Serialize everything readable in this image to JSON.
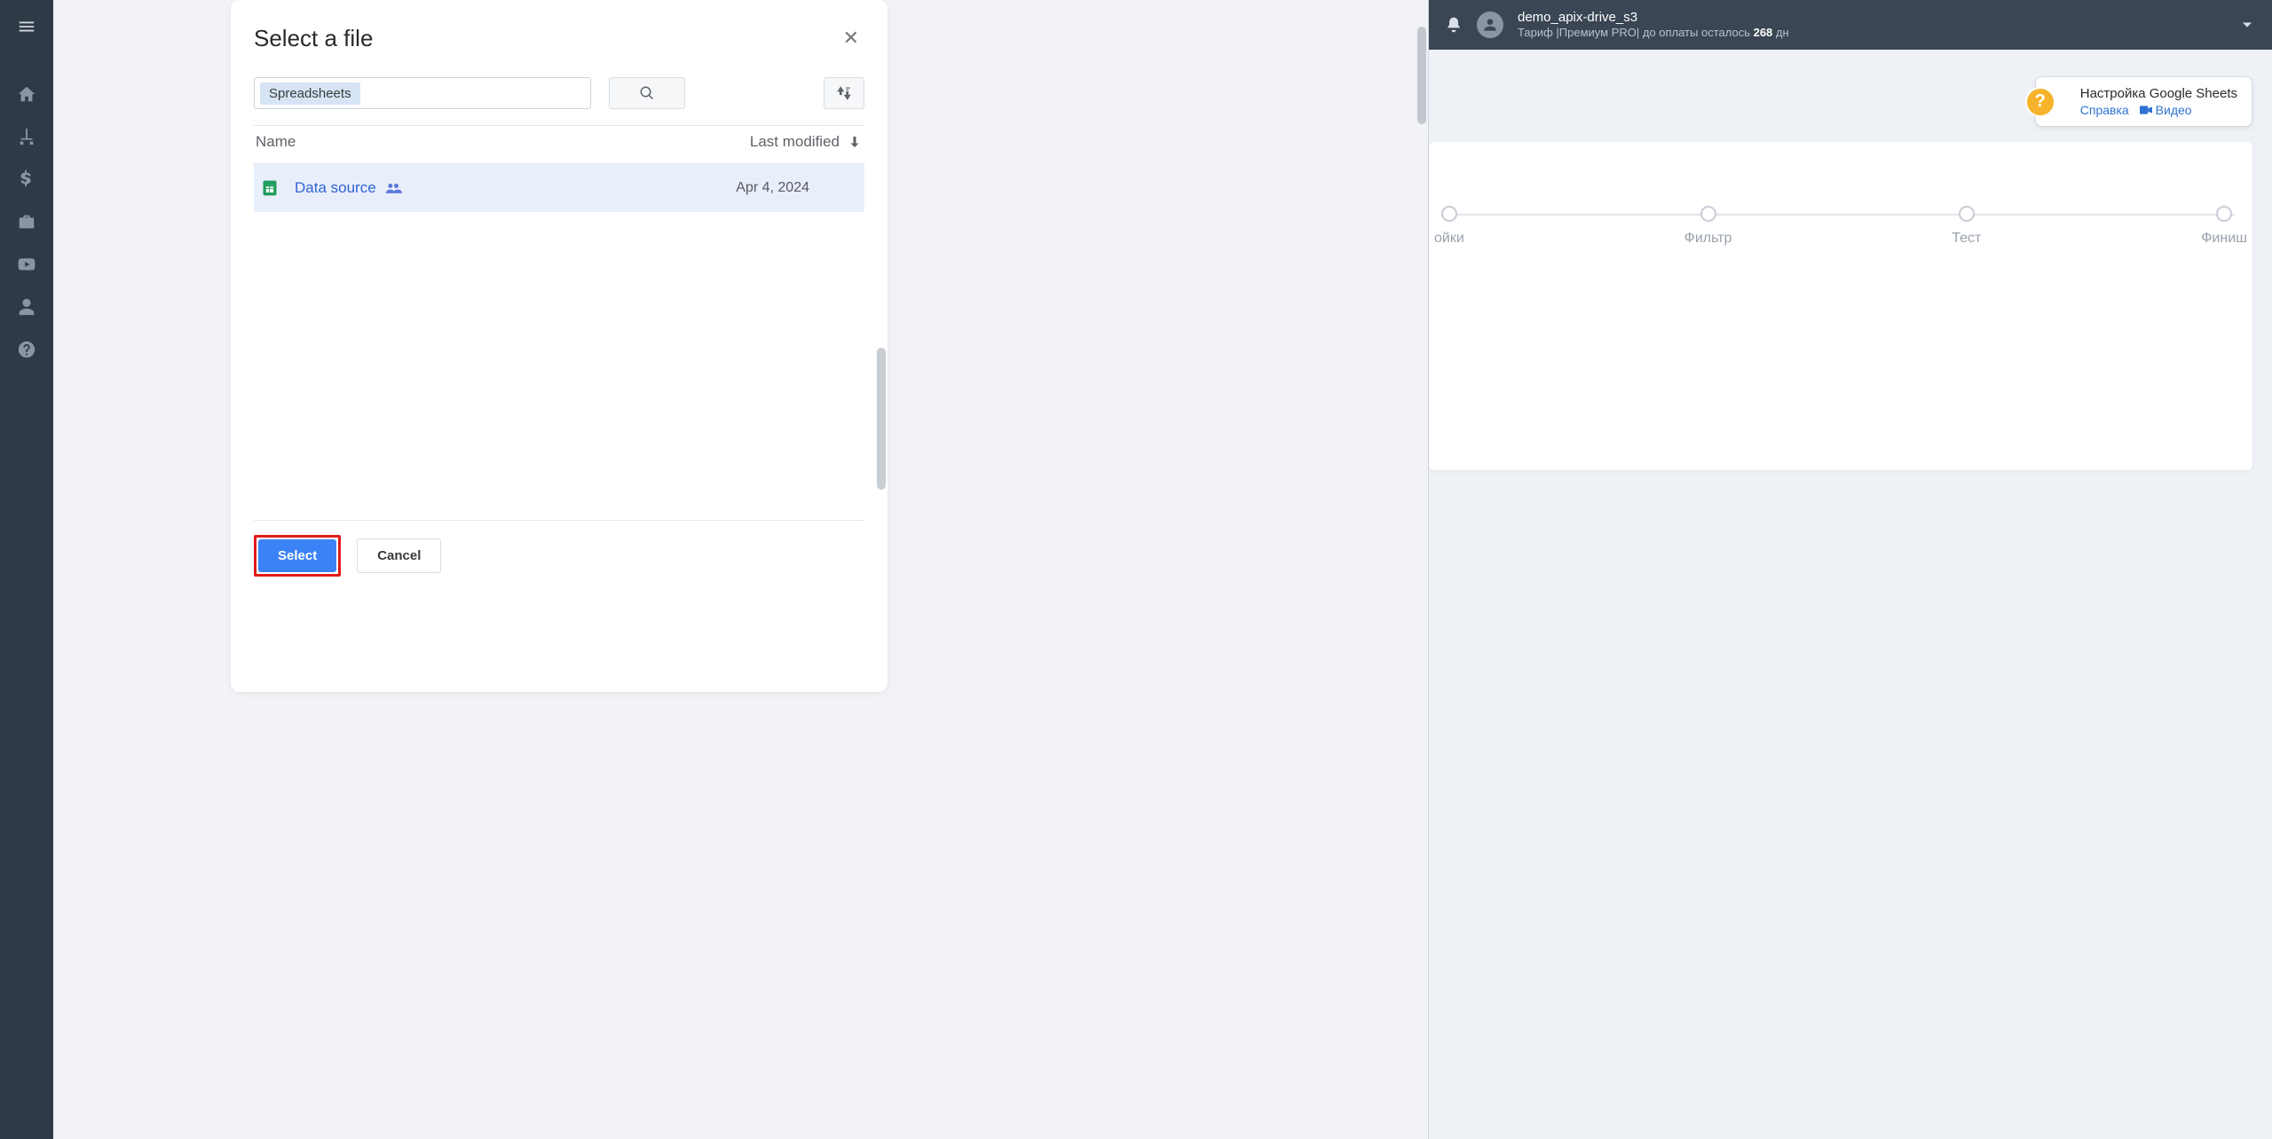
{
  "sidebar": {
    "icons": [
      "menu",
      "home",
      "sitemap",
      "dollar",
      "briefcase",
      "youtube",
      "user",
      "help"
    ]
  },
  "picker": {
    "title": "Select a file",
    "chip": "Spreadsheets",
    "columns": {
      "name": "Name",
      "modified": "Last modified"
    },
    "files": [
      {
        "name": "Data source",
        "date": "Apr 4, 2024"
      }
    ],
    "buttons": {
      "select": "Select",
      "cancel": "Cancel"
    }
  },
  "topbar": {
    "username": "demo_apix-drive_s3",
    "tariff_prefix": "Тариф |Премиум PRO| до оплаты осталось ",
    "tariff_days": "268",
    "tariff_suffix": " дн"
  },
  "help": {
    "title": "Настройка Google Sheets",
    "ref": "Справка",
    "video": "Видео"
  },
  "wizard": {
    "steps": [
      "ойки",
      "Фильтр",
      "Тест",
      "Финиш"
    ]
  }
}
